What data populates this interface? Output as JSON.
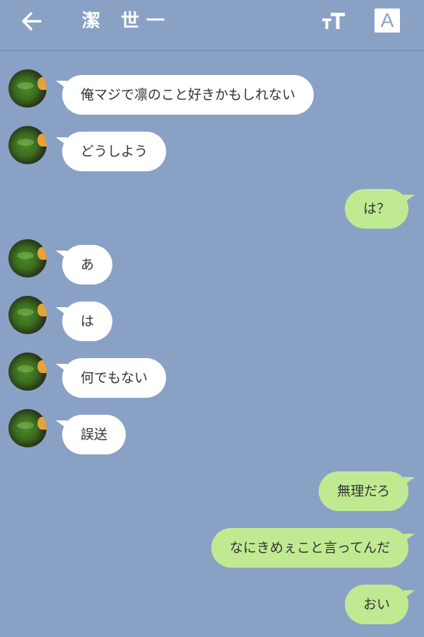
{
  "header": {
    "title": "潔 世一",
    "back_icon": "back-arrow-icon",
    "font_size_icon": "font-size-icon",
    "translate_label": "A"
  },
  "colors": {
    "background": "#8aa1c6",
    "incoming_bubble": "#ffffff",
    "outgoing_bubble": "#c0ea92",
    "text": "#333333"
  },
  "messages": [
    {
      "sender": "other",
      "text": "俺マジで凛のこと好きかもしれない"
    },
    {
      "sender": "other",
      "text": "どうしよう"
    },
    {
      "sender": "me",
      "text": "は？"
    },
    {
      "sender": "other",
      "text": "あ"
    },
    {
      "sender": "other",
      "text": "は"
    },
    {
      "sender": "other",
      "text": "何でもない"
    },
    {
      "sender": "other",
      "text": "誤送"
    },
    {
      "sender": "me",
      "text": "無理だろ"
    },
    {
      "sender": "me",
      "text": "なにきめぇこと言ってんだ"
    },
    {
      "sender": "me",
      "text": "おい"
    }
  ]
}
